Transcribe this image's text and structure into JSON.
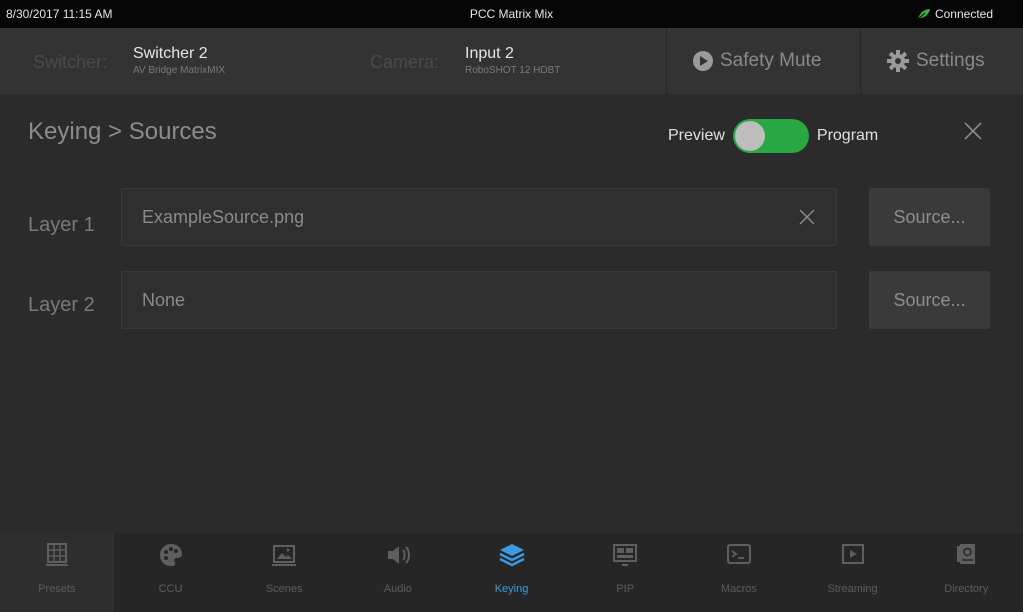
{
  "status": {
    "datetime": "8/30/2017 11:15 AM",
    "app_title": "PCC Matrix Mix",
    "connection": "Connected"
  },
  "header": {
    "switcher_label": "Switcher:",
    "switcher_name": "Switcher 2",
    "switcher_model": "AV Bridge MatrixMIX",
    "camera_label": "Camera:",
    "camera_name": "Input 2",
    "camera_model": "RoboSHOT 12 HDBT",
    "safety_mute": "Safety Mute",
    "settings": "Settings"
  },
  "page": {
    "title": "Keying > Sources",
    "toggle_left": "Preview",
    "toggle_right": "Program"
  },
  "layers": [
    {
      "label": "Layer 1",
      "value": "ExampleSource.png",
      "button": "Source..."
    },
    {
      "label": "Layer 2",
      "value": "None",
      "button": "Source..."
    }
  ],
  "nav": [
    {
      "label": "Presets",
      "icon": "presets-grid-icon"
    },
    {
      "label": "CCU",
      "icon": "palette-icon"
    },
    {
      "label": "Scenes",
      "icon": "scene-image-icon"
    },
    {
      "label": "Audio",
      "icon": "speaker-icon"
    },
    {
      "label": "Keying",
      "icon": "layers-icon",
      "active": true
    },
    {
      "label": "PIP",
      "icon": "pip-icon"
    },
    {
      "label": "Macros",
      "icon": "terminal-icon"
    },
    {
      "label": "Streaming",
      "icon": "play-box-icon"
    },
    {
      "label": "Directory",
      "icon": "directory-icon"
    }
  ],
  "colors": {
    "accent": "#3b9ae1",
    "toggle_on": "#28a745",
    "connected": "#3cb043"
  }
}
